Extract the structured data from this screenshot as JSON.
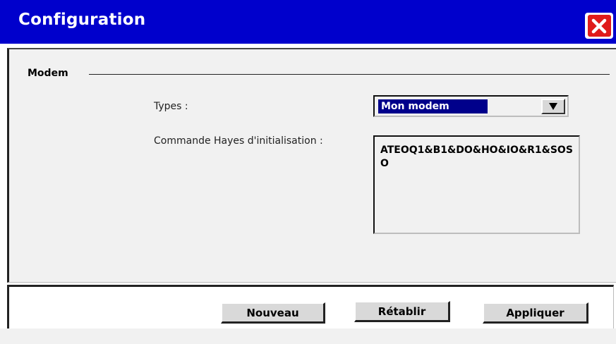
{
  "window": {
    "title": "Configuration"
  },
  "icons": {
    "close": "close-icon",
    "dropdown": "triangle-down-icon"
  },
  "colors": {
    "titlebar": "#0000cc",
    "close": "#e01b1b",
    "selection": "#00008b"
  },
  "modem": {
    "group_label": "Modem",
    "types_label": "Types :",
    "types_value": "Mon modem",
    "hayes_label": "Commande Hayes d'initialisation :",
    "hayes_value": "ATEOQ1&B1&DO&HO&IO&R1&SOSO"
  },
  "buttons": {
    "new": "Nouveau",
    "restore": "Rétablir",
    "apply": "Appliquer"
  }
}
